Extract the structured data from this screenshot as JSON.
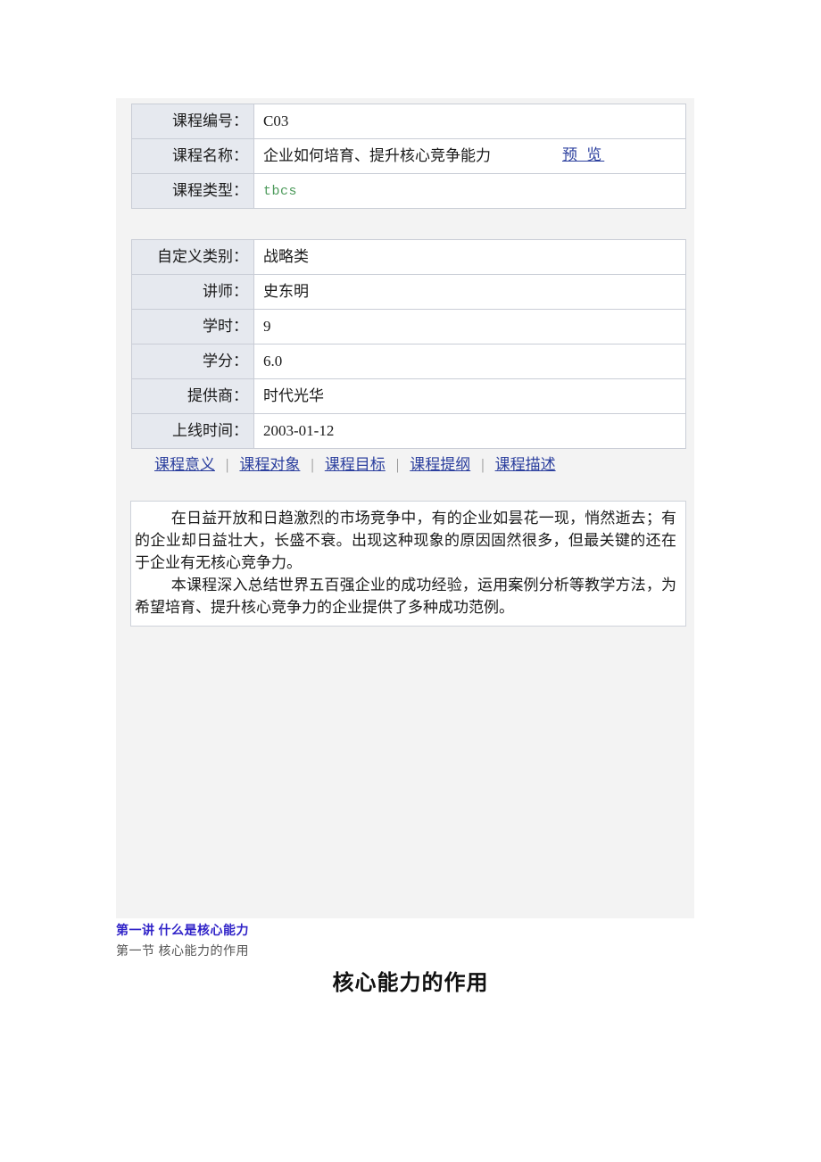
{
  "course_top": {
    "rows": [
      {
        "label": "课程编号：",
        "value": "C03",
        "type": "text"
      },
      {
        "label": "课程名称：",
        "value": "企业如何培育、提升核心竞争能力",
        "type": "text"
      },
      {
        "label": "课程类型：",
        "value": "tbcs",
        "type": "green"
      }
    ],
    "preview_label": "预 览"
  },
  "course_meta": {
    "rows": [
      {
        "label": "自定义类别：",
        "value": "战略类"
      },
      {
        "label": "讲师：",
        "value": "史东明"
      },
      {
        "label": "学时：",
        "value": "9"
      },
      {
        "label": "学分：",
        "value": "6.0"
      },
      {
        "label": "提供商：",
        "value": "时代光华"
      },
      {
        "label": "上线时间：",
        "value": "2003-01-12"
      }
    ]
  },
  "tabs": {
    "separator": "|",
    "items": [
      {
        "label": "课程意义"
      },
      {
        "label": "课程对象"
      },
      {
        "label": "课程目标"
      },
      {
        "label": "课程提纲"
      },
      {
        "label": "课程描述"
      }
    ]
  },
  "description": {
    "paragraphs": [
      "在日益开放和日趋激烈的市场竞争中，有的企业如昙花一现，悄然逝去；有的企业却日益壮大，长盛不衰。出现这种现象的原因固然很多，但最关键的还在于企业有无核心竞争力。",
      "本课程深入总结世界五百强企业的成功经验，运用案例分析等教学方法，为希望培育、提升核心竞争力的企业提供了多种成功范例。"
    ]
  },
  "outline": {
    "chapter": "第一讲 什么是核心能力",
    "section": "第一节 核心能力的作用",
    "title": "核心能力的作用"
  },
  "colors": {
    "link": "#2b3f9e",
    "chapter": "#3023c8",
    "type_value": "#4c9a5a",
    "panel_bg": "#f3f3f3",
    "label_bg": "#e6e9ef",
    "border": "#c9cdd6"
  }
}
